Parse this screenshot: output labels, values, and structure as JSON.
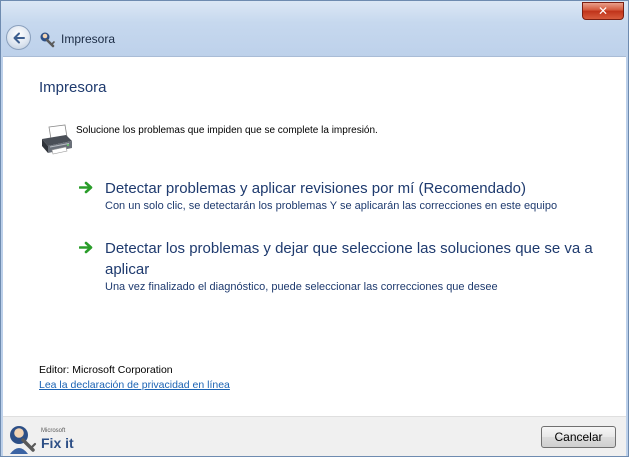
{
  "window": {
    "title": "Impresora",
    "close_symbol": "✕"
  },
  "icons": {
    "back": "back-arrow-icon",
    "title": "fixit-wrench-icon",
    "printer": "printer-icon",
    "option_arrow": "green-arrow-icon",
    "logo": "microsoft-fixit-logo"
  },
  "page": {
    "heading": "Impresora",
    "description": "Solucione los problemas que impiden que se complete la impresión."
  },
  "options": [
    {
      "title": "Detectar problemas y aplicar revisiones por mí (Recomendado)",
      "subtitle": "Con un solo clic, se detectarán los problemas Y se aplicarán las correcciones en este equipo"
    },
    {
      "title": "Detectar los problemas y dejar que seleccione las soluciones que se va a aplicar",
      "subtitle": "Una vez finalizado el diagnóstico, puede seleccionar las correcciones que desee"
    }
  ],
  "footer": {
    "publisher": "Editor: Microsoft Corporation",
    "privacy_link": "Lea la declaración de privacidad en línea",
    "cancel_label": "Cancelar",
    "logo_brand": "Microsoft",
    "logo_text": "Fix it"
  },
  "colors": {
    "accent_text": "#1e3a6e",
    "link": "#1a62b3",
    "arrow_green": "#2a9d2a",
    "close_red": "#c0321a"
  }
}
